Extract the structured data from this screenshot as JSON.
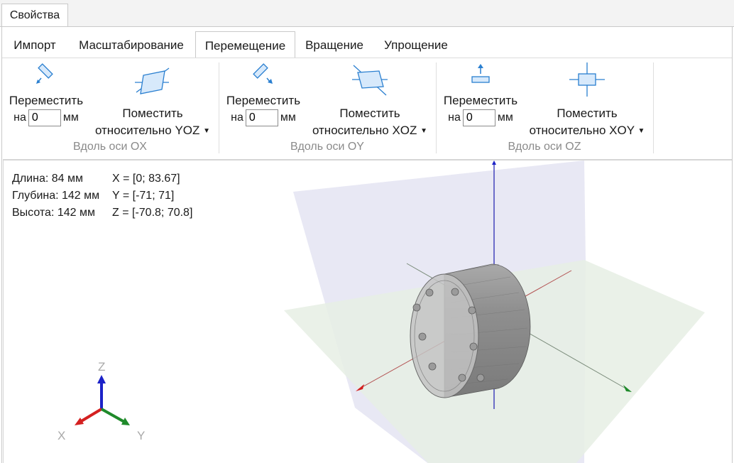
{
  "window": {
    "tab_title": "Свойства"
  },
  "ribbon": {
    "tabs": [
      {
        "label": "Импорт"
      },
      {
        "label": "Масштабирование"
      },
      {
        "label": "Перемещение"
      },
      {
        "label": "Вращение"
      },
      {
        "label": "Упрощение"
      }
    ],
    "active_tab": "Перемещение",
    "groups": [
      {
        "label": "Вдоль оси OX",
        "move_label": "Переместить",
        "on_label": "на",
        "value": "0",
        "unit": "мм",
        "place_line1": "Поместить",
        "place_line2": "относительно YOZ",
        "move_icon": "arrow-diag-icon",
        "place_icon": "plane-yoz-icon"
      },
      {
        "label": "Вдоль оси OY",
        "move_label": "Переместить",
        "on_label": "на",
        "value": "0",
        "unit": "мм",
        "place_line1": "Поместить",
        "place_line2": "относительно XOZ",
        "move_icon": "arrow-diag-icon",
        "place_icon": "plane-xoz-icon"
      },
      {
        "label": "Вдоль оси OZ",
        "move_label": "Переместить",
        "on_label": "на",
        "value": "0",
        "unit": "мм",
        "place_line1": "Поместить",
        "place_line2": "относительно XOY",
        "move_icon": "arrow-up-icon",
        "place_icon": "plane-xoy-icon"
      }
    ]
  },
  "viewport": {
    "dimensions": [
      {
        "label": "Длина: 84 мм",
        "range": "X = [0; 83.67]"
      },
      {
        "label": "Глубина: 142 мм",
        "range": "Y = [-71; 71]"
      },
      {
        "label": "Высота: 142 мм",
        "range": "Z = [-70.8; 70.8]"
      }
    ],
    "axes": {
      "x": "X",
      "y": "Y",
      "z": "Z"
    },
    "colors": {
      "x_axis": "#d42020",
      "y_axis": "#1f8a2a",
      "z_axis": "#1c22c8",
      "icon": "#2a7fd0"
    }
  }
}
